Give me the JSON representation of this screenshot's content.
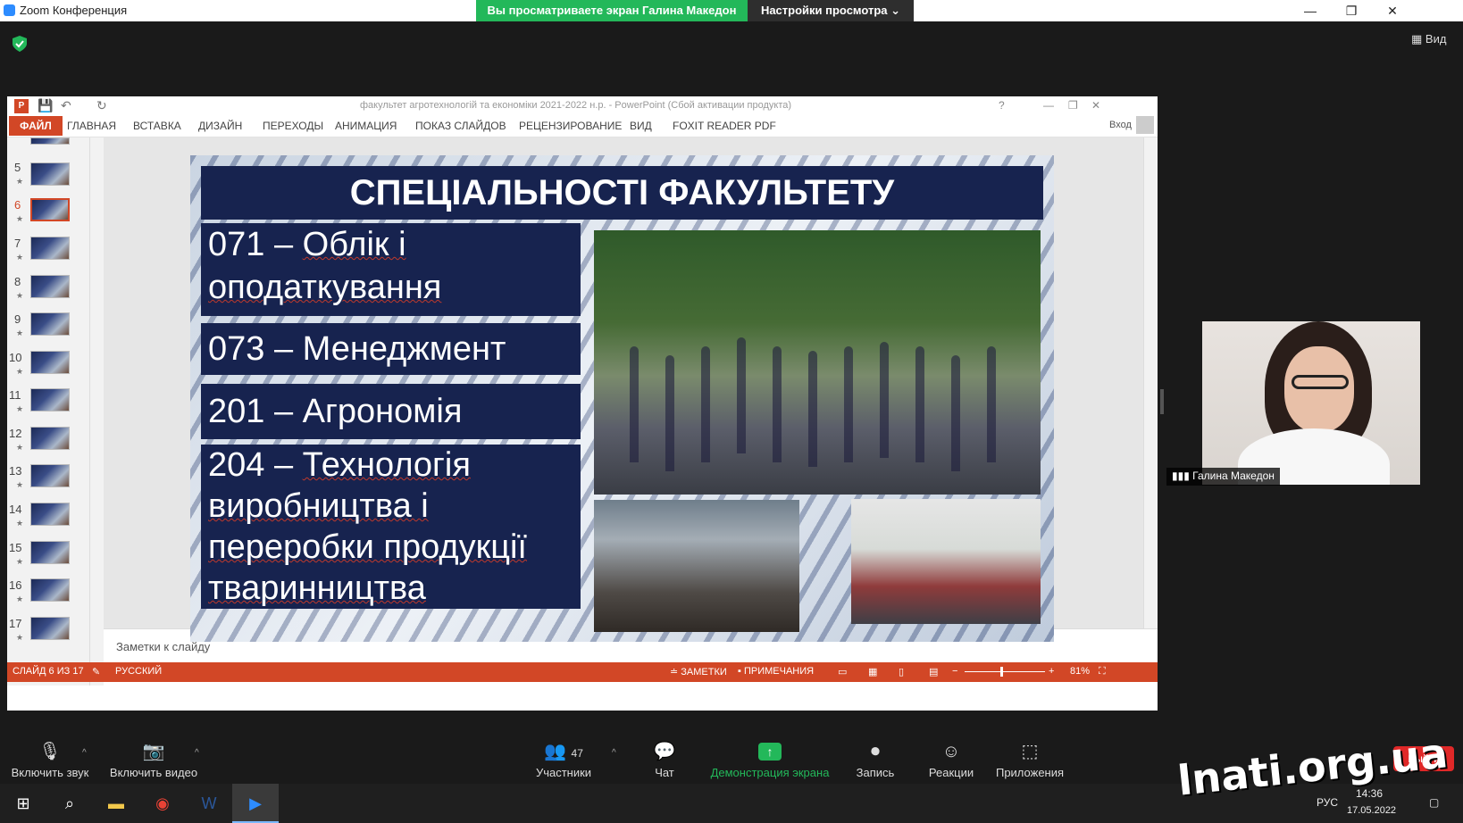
{
  "zoom": {
    "window_title": "Zoom Конференция",
    "share_banner": "Вы просматриваете экран Галина Македон",
    "view_settings": "Настройки просмотра ⌄",
    "view_button": "Вид"
  },
  "powerpoint": {
    "window_title": "факультет агротехнологій та економіки 2021-2022 н.р. - PowerPoint (Сбой активации продукта)",
    "ribbon_tabs": [
      "ФАЙЛ",
      "ГЛАВНАЯ",
      "ВСТАВКА",
      "ДИЗАЙН",
      "ПЕРЕХОДЫ",
      "АНИМАЦИЯ",
      "ПОКАЗ СЛАЙДОВ",
      "РЕЦЕНЗИРОВАНИЕ",
      "ВИД",
      "FOXIT READER PDF"
    ],
    "login": "Вход",
    "thumbnails": [
      "5",
      "6",
      "7",
      "8",
      "9",
      "10",
      "11",
      "12",
      "13",
      "14",
      "15",
      "16",
      "17"
    ],
    "selected_thumbnail": "6",
    "notes_placeholder": "Заметки к слайду",
    "status": {
      "slide_counter": "СЛАЙД 6 ИЗ 17",
      "language": "РУССКИЙ",
      "notes": "ЗАМЕТКИ",
      "comments": "ПРИМЕЧАНИЯ",
      "zoom": "81%"
    }
  },
  "slide": {
    "title": "СПЕЦІАЛЬНОСТІ ФАКУЛЬТЕТУ",
    "specialties": [
      {
        "code": "071 – ",
        "name": "Облік і оподаткування"
      },
      {
        "code": "073 – ",
        "name": "Менеджмент"
      },
      {
        "code": "201 – ",
        "name": "Агрономія"
      },
      {
        "code": "204 – ",
        "name": "Технологія виробництва і переробки продукції тваринництва"
      }
    ]
  },
  "video": {
    "participant_name": "Галина Македон"
  },
  "toolbar": {
    "mute": "Включить звук",
    "video": "Включить видео",
    "participants": "Участники",
    "participants_count": "47",
    "chat": "Чат",
    "share": "Демонстрация экрана",
    "record": "Запись",
    "reactions": "Реакции",
    "apps": "Приложения",
    "exit": "Выйти"
  },
  "taskbar": {
    "language": "РУС",
    "time": "14:36",
    "date": "17.05.2022"
  },
  "watermark": "lnati.org.ua"
}
